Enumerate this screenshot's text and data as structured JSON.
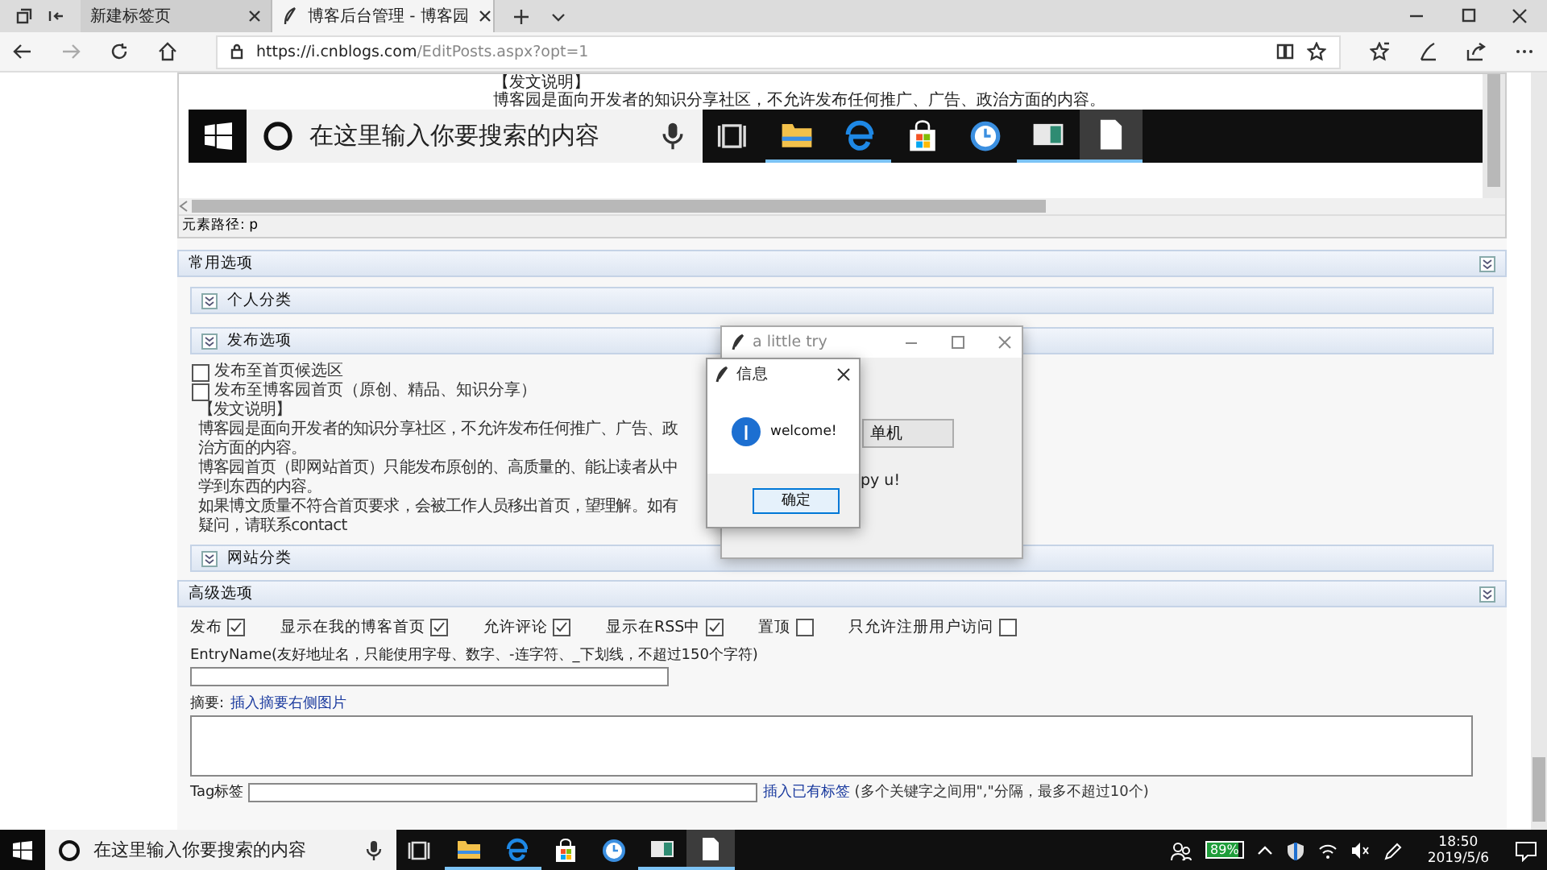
{
  "browser": {
    "tabs": [
      {
        "label": "新建标签页",
        "selected": false
      },
      {
        "label": "博客后台管理 - 博客园",
        "selected": true
      }
    ],
    "url_host": "https://i.cnblogs.com",
    "url_path": "/EditPosts.aspx?opt=1"
  },
  "editor": {
    "lines": [
      "【发文说明】",
      "博客园是面向开发者的知识分享社区，不允许发布任何推广、广告、政治方面的内容。"
    ],
    "embedded_taskbar": {
      "search_placeholder": "在这里输入你要搜索的内容"
    },
    "element_path": "元素路径: p"
  },
  "common_options": {
    "title": "常用选项",
    "personal_category": "个人分类",
    "publish_options": {
      "title": "发布选项",
      "checkboxes": [
        {
          "label": "发布至首页候选区",
          "checked": false
        },
        {
          "label": "发布至博客园首页（原创、精品、知识分享）",
          "checked": false
        }
      ],
      "notes": [
        "【发文说明】",
        "博客园是面向开发者的知识分享社区，不允许发布任何推广、广告、政治方面的内容。",
        "博客园首页（即网站首页）只能发布原创的、高质量的、能让读者从中学到东西的内容。",
        "如果博文质量不符合首页要求，会被工作人员移出首页，望理解。如有疑问，请联系contact"
      ]
    },
    "site_category": "网站分类"
  },
  "advanced_options": {
    "title": "高级选项",
    "options": [
      {
        "label": "发布",
        "checked": true
      },
      {
        "label": "显示在我的博客首页",
        "checked": true
      },
      {
        "label": "允许评论",
        "checked": true
      },
      {
        "label": "显示在RSS中",
        "checked": true
      },
      {
        "label": "置顶",
        "checked": false
      },
      {
        "label": "只允许注册用户访问",
        "checked": false
      }
    ],
    "entry_name_label": "EntryName(友好地址名，只能使用字母、数字、-连字符、_下划线，不超过150个字符)",
    "summary_label": "摘要:",
    "summary_link": "插入摘要右侧图片",
    "tag_label": "Tag标签",
    "tag_link": "插入已有标签",
    "tag_hint": "(多个关键字之间用\",\"分隔，最多不超过10个)"
  },
  "app_window": {
    "title": "a little try",
    "button": "单机",
    "text": "py u!"
  },
  "message_box": {
    "title": "信息",
    "message": "welcome!",
    "ok_button": "确定"
  },
  "taskbar": {
    "search_placeholder": "在这里输入你要搜索的内容",
    "battery": "89%",
    "time": "18:50",
    "date": "2019/5/6"
  }
}
